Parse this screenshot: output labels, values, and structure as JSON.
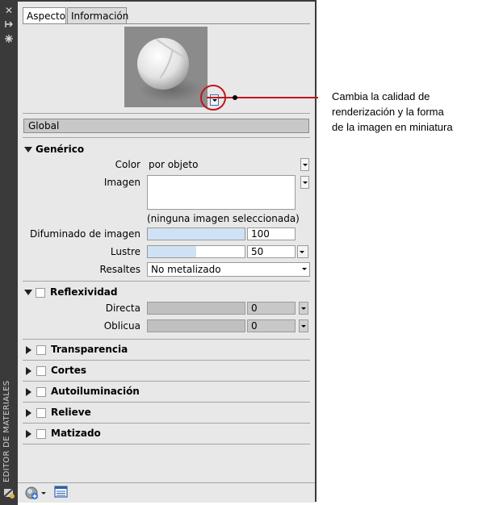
{
  "side_strip": {
    "title": "EDITOR DE MATERIALES",
    "icons": [
      "close-icon",
      "pin-icon",
      "properties-icon"
    ]
  },
  "tabs": [
    "Aspecto",
    "Información"
  ],
  "active_tab": "Aspecto",
  "global_label": "Global",
  "generic": {
    "title": "Genérico",
    "color_label": "Color",
    "color_value": "por objeto",
    "image_label": "Imagen",
    "image_note": "(ninguna imagen seleccionada)",
    "fade_label": "Difuminado de imagen",
    "fade_value": "100",
    "fade_level": 1.0,
    "gloss_label": "Lustre",
    "gloss_value": "50",
    "gloss_level": 0.5,
    "highlights_label": "Resaltes",
    "highlights_value": "No metalizado"
  },
  "reflectivity": {
    "title": "Reflexividad",
    "direct_label": "Directa",
    "direct_value": "0",
    "oblique_label": "Oblicua",
    "oblique_value": "0"
  },
  "sections": [
    "Transparencia",
    "Cortes",
    "Autoiluminación",
    "Relieve",
    "Matizado"
  ],
  "callout": {
    "line1": "Cambia la calidad de",
    "line2": "renderización y la forma",
    "line3": "de la imagen en miniatura"
  },
  "colors": {
    "callout_red": "#c0161c",
    "panel_bg": "#e8e8e8",
    "strip_bg": "#3a3a3a"
  }
}
